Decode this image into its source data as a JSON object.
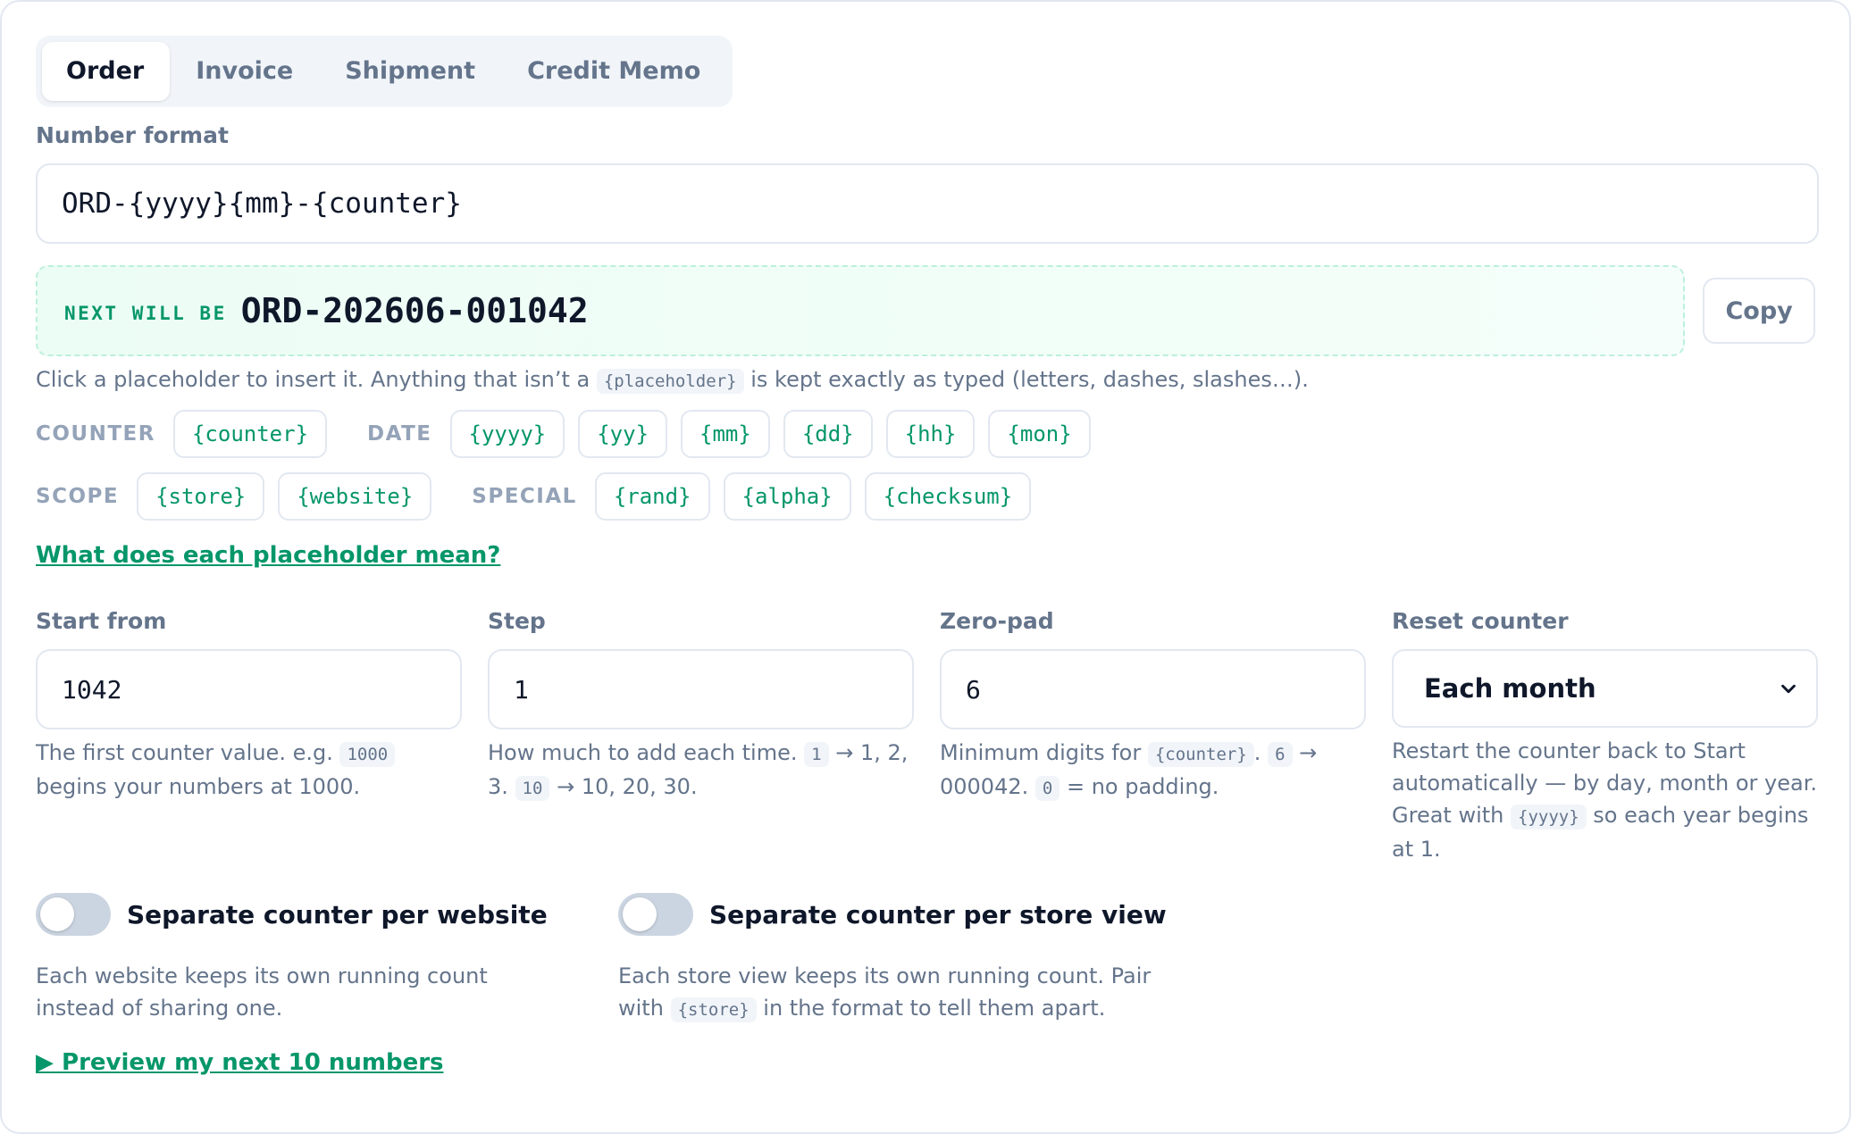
{
  "tabs": [
    {
      "label": "Order",
      "active": true
    },
    {
      "label": "Invoice",
      "active": false
    },
    {
      "label": "Shipment",
      "active": false
    },
    {
      "label": "Credit Memo",
      "active": false
    }
  ],
  "format": {
    "label": "Number format",
    "value": "ORD-{yyyy}{mm}-{counter}"
  },
  "next": {
    "label": "NEXT WILL BE",
    "value": "ORD-202606-001042",
    "copy_label": "Copy"
  },
  "help_text": {
    "before": "Click a placeholder to insert it. Anything that isn’t a",
    "code": "{placeholder}",
    "after": "is kept exactly as typed (letters, dashes, slashes…)."
  },
  "placeholder_groups": [
    {
      "label": "COUNTER",
      "chips": [
        "{counter}"
      ]
    },
    {
      "label": "DATE",
      "chips": [
        "{yyyy}",
        "{yy}",
        "{mm}",
        "{dd}",
        "{hh}",
        "{mon}"
      ]
    },
    {
      "label": "SCOPE",
      "chips": [
        "{store}",
        "{website}"
      ]
    },
    {
      "label": "SPECIAL",
      "chips": [
        "{rand}",
        "{alpha}",
        "{checksum}"
      ]
    }
  ],
  "placeholder_link": "What does each placeholder mean?",
  "fields": {
    "start": {
      "label": "Start from",
      "value": "1042",
      "help_1": "The first counter value. e.g.",
      "help_code": "1000",
      "help_2": "begins your numbers at 1000."
    },
    "step": {
      "label": "Step",
      "value": "1",
      "help_1": "How much to add each time.",
      "help_code_1": "1",
      "help_2": "→ 1, 2, 3.",
      "help_code_2": "10",
      "help_3": "→ 10, 20, 30."
    },
    "zeropad": {
      "label": "Zero-pad",
      "value": "6",
      "help_1": "Minimum digits for",
      "help_code_1": "{counter}",
      "help_2": ".",
      "help_code_2": "6",
      "help_3": "→ 000042.",
      "help_code_3": "0",
      "help_4": "= no padding."
    },
    "reset": {
      "label": "Reset counter",
      "value": "Each month",
      "help_1": "Restart the counter back to Start automatically — by day, month or year. Great with",
      "help_code": "{yyyy}",
      "help_2": "so each year begins at 1."
    }
  },
  "toggles": [
    {
      "label": "Separate counter per website",
      "on": false,
      "help_1": "Each website keeps its own running count instead of sharing one."
    },
    {
      "label": "Separate counter per store view",
      "on": false,
      "help_1": "Each store view keeps its own running count. Pair with",
      "help_code": "{store}",
      "help_2": "in the format to tell them apart."
    }
  ],
  "preview_link": "▶ Preview my next 10 numbers",
  "colors": {
    "accent": "#059669",
    "muted": "#64748b",
    "border": "#e2e8f0",
    "success_bg": "#ecfdf5"
  }
}
